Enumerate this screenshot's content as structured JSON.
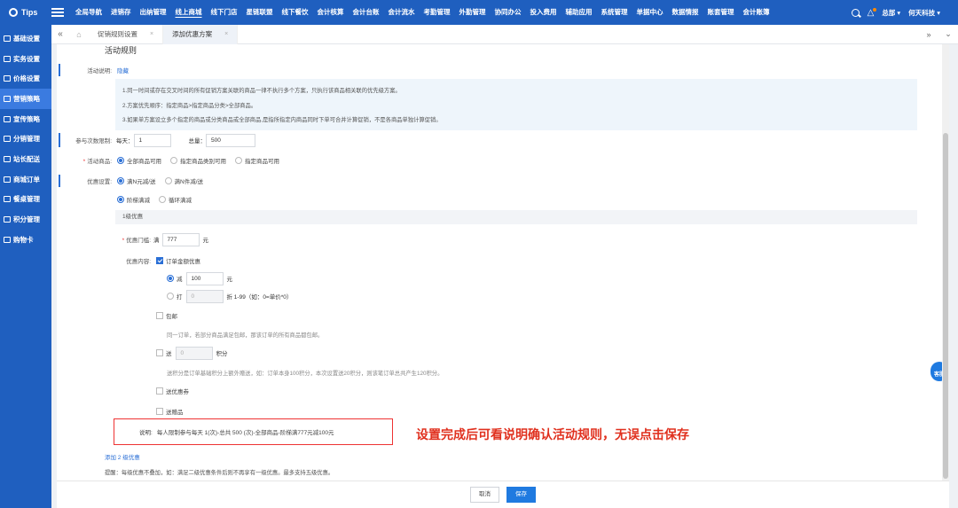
{
  "nav": {
    "logo": "Tips",
    "menu": [
      "全局导航",
      "进销存",
      "出纳管理",
      "线上商城",
      "线下门店",
      "星链联盟",
      "线下餐饮",
      "会计核算",
      "会计台账",
      "会计流水",
      "考勤管理",
      "外勤管理",
      "协同办公",
      "投入费用",
      "辅助应用",
      "系统管理",
      "单据中心",
      "数据情报",
      "账套管理",
      "会计账簿"
    ],
    "active_index": 3,
    "user": "总部 ▾",
    "company": "何天科技 ▾"
  },
  "sidebar": {
    "items": [
      {
        "label": "基础设置"
      },
      {
        "label": "实务设置"
      },
      {
        "label": "价格设置"
      },
      {
        "label": "营销策略"
      },
      {
        "label": "宣传策略"
      },
      {
        "label": "分销管理"
      },
      {
        "label": "站长配送"
      },
      {
        "label": "商城订单"
      },
      {
        "label": "餐桌管理"
      },
      {
        "label": "积分管理"
      },
      {
        "label": "购物卡"
      }
    ],
    "active_index": 3
  },
  "tabs": [
    {
      "label": "促销规则设置",
      "close": "×"
    },
    {
      "label": "添加优惠方案",
      "close": "×"
    }
  ],
  "form": {
    "section_title": "活动规则",
    "desc_label": "活动说明:",
    "hide_link": "隐藏",
    "notice": [
      "1.同一时间或存在交叉时间的所有促销方案关联的商品一律不执行多个方案，只执行该商品相关联的优先级方案。",
      "2.方案优先顺序：指定商品>指定商品分类>全部商品。",
      "3.如果单方案设立多个指定的商品或分类商品或全部商品,是指所指定内商品同时下单可合并计算促销，不是各商品单独计算促销。"
    ],
    "limit_label": "参与次数限制:",
    "per_day_label": "每天：",
    "per_day_value": "1",
    "total_label": "总量：",
    "total_value": "500",
    "goods_label": "活动商品:",
    "goods_options": [
      "全部商品可用",
      "指定商品类别可用",
      "指定商品可用"
    ],
    "promo_label": "优惠设置:",
    "promo_options": [
      "满N元减/送",
      "满N件减/送"
    ],
    "mode_options": [
      "阶梯满减",
      "循环满减"
    ],
    "level_title": "1级优惠",
    "threshold_label": "优惠门槛:",
    "threshold_prefix": "满",
    "threshold_value": "777",
    "threshold_unit": "元",
    "content_label": "优惠内容:",
    "order_discount": "订单金额优惠",
    "minus_label": "减",
    "minus_value": "100",
    "minus_unit": "元",
    "discount_label": "打",
    "discount_value": "0",
    "discount_hint": "折 1-99（如：0=单价*0）",
    "free_ship": "包邮",
    "free_ship_hint": "同一订单，若部分商品满足包邮，那该订单的所有商品都包邮。",
    "points_label": "送",
    "points_value": "0",
    "points_unit": "积分",
    "points_hint": "送积分是订单基础积分上额外赠送，如：订单本身100积分，本次设置送20积分，则该笔订单总共产生120积分。",
    "coupon": "送优惠券",
    "gift": "送赠品",
    "explain_label": "说明:",
    "explain_text": "每人限制参与每天 1(次)-总共 500 (次)-全部商品-阶梯满777元减100元",
    "add_level": "添加 2 级优惠",
    "reminder": "提醒：每级优惠不叠加，如：满足二级优惠条件后则不再享有一级优惠。最多支持五级优惠。"
  },
  "annotation": "设置完成后可看说明确认活动规则，无误点击保存",
  "service_label": "客服",
  "footer": {
    "cancel": "取消",
    "save": "保存"
  }
}
